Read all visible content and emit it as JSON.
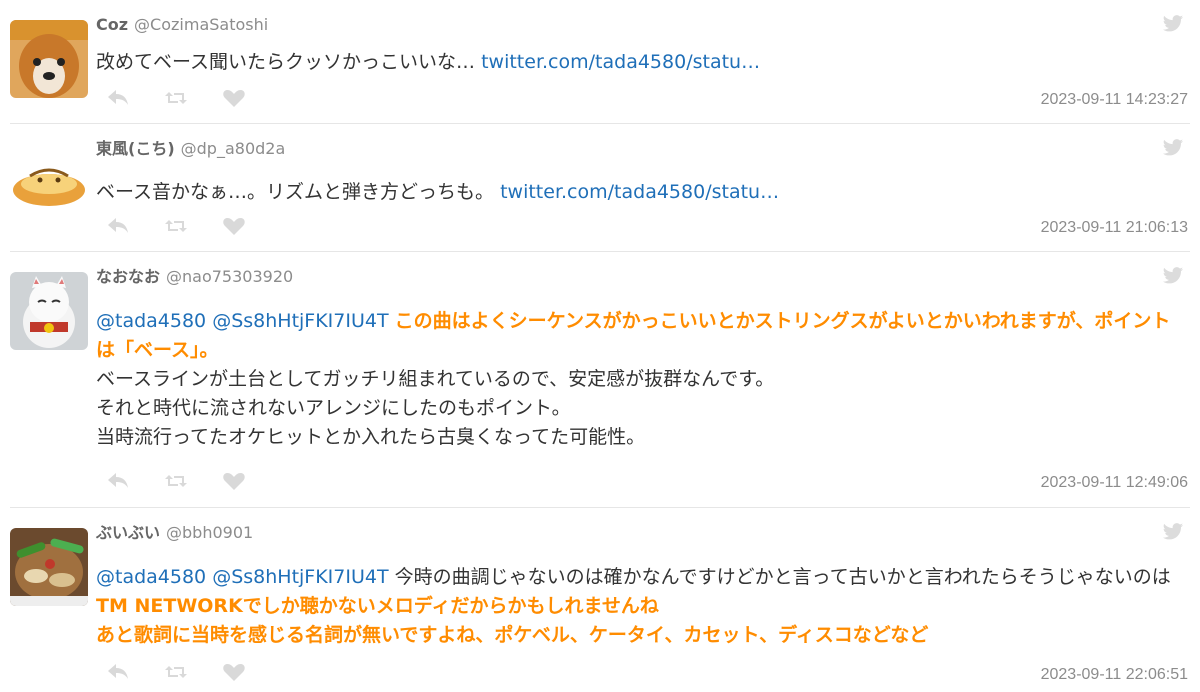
{
  "tweets": [
    {
      "name": "Coz",
      "handle": "@CozimaSatoshi",
      "text": "改めてベース聞いたらクッソかっこいいな… ",
      "link": "twitter.com/tada4580/statu…",
      "timestamp": "2023-09-11 14:23:27"
    },
    {
      "name": "東風(こち)",
      "handle": "@dp_a80d2a",
      "text": "ベース音かなぁ…。リズムと弾き方どっちも。 ",
      "link": "twitter.com/tada4580/statu…",
      "timestamp": "2023-09-11 21:06:13"
    },
    {
      "name": "なおなお",
      "handle": "@nao75303920",
      "mentions": "@tada4580 @Ss8hHtjFKI7IU4T ",
      "highlight": "この曲はよくシーケンスがかっこいいとかストリングスがよいとかいわれますが、ポイントは「ベース」。",
      "lines": [
        "ベースラインが土台としてガッチリ組まれているので、安定感が抜群なんです。",
        "それと時代に流されないアレンジにしたのもポイント。",
        "当時流行ってたオケヒットとか入れたら古臭くなってた可能性。"
      ],
      "timestamp": "2023-09-11 12:49:06"
    },
    {
      "name": "ぶいぶい",
      "handle": "@bbh0901",
      "mentions": "@tada4580 @Ss8hHtjFKI7IU4T ",
      "text": "今時の曲調じゃないのは確かなんですけどかと言って古いかと言われたらそうじゃないのは",
      "highlight1": "TM NETWORKでしか聴かないメロディだからかもしれませんね",
      "highlight2": "あと歌詞に当時を感じる名詞が無いですよね、ポケベル、ケータイ、カセット、ディスコなどなど",
      "timestamp": "2023-09-11 22:06:51"
    }
  ],
  "icons": [
    "reply-icon",
    "retweet-icon",
    "like-icon",
    "twitter-bird-icon"
  ],
  "colors": {
    "link": "#1f6fb8",
    "highlight": "#ff8c00",
    "meta": "#8c8c8c",
    "icon": "#d9d9d9"
  }
}
